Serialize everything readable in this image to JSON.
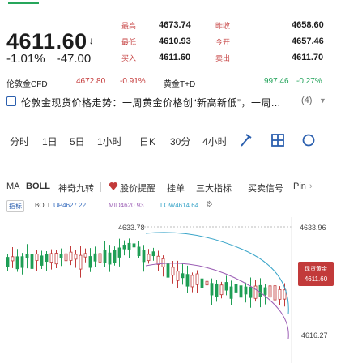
{
  "quote": {
    "price": "4611.60",
    "arrow": "↓",
    "change_pct": "-1.01%",
    "change_abs": "-47.00",
    "rows": [
      {
        "label1": "最高",
        "val1": "4673.74",
        "label2": "昨收",
        "val2": "4658.60"
      },
      {
        "label1": "最低",
        "val1": "4610.93",
        "label2": "今开",
        "val2": "4657.46"
      },
      {
        "label1": "买入",
        "val1": "4611.60",
        "label2": "卖出",
        "val2": "4611.70"
      }
    ]
  },
  "ticker": {
    "name1": "伦敦金CFD",
    "price1": "4672.80",
    "pct1": "-0.91%",
    "name2": "黄金T+D",
    "price2": "997.46",
    "pct2": "-0.27%"
  },
  "news": {
    "text": "伦敦金现货价格走势：一周黄金价格创“新高新低”，一周...",
    "count": "(4)"
  },
  "periods": [
    "分时",
    "1日",
    "5日",
    "1小时",
    "日K",
    "30分",
    "4小时"
  ],
  "indicators": {
    "items": [
      "MA",
      "BOLL",
      "神奇九转",
      "股价提醒",
      "挂单",
      "三大指标",
      "买卖信号",
      "Pin"
    ],
    "more": "›"
  },
  "boll": {
    "tag": "指标",
    "name": "BOLL",
    "up": "UP4627.22",
    "mid": "MID4620.93",
    "low": "LOW4614.64"
  },
  "chart": {
    "label_left": "4633.78",
    "label_right": "4633.96",
    "label_low": "4616.27",
    "badge_line1": "现货黄金",
    "badge_line2": "4611.60",
    "colors": {
      "up": "#c23a3a",
      "down": "#1f9e55",
      "boll_mid": "#9c5fb5",
      "boll_band": "#3aa5c9"
    }
  }
}
